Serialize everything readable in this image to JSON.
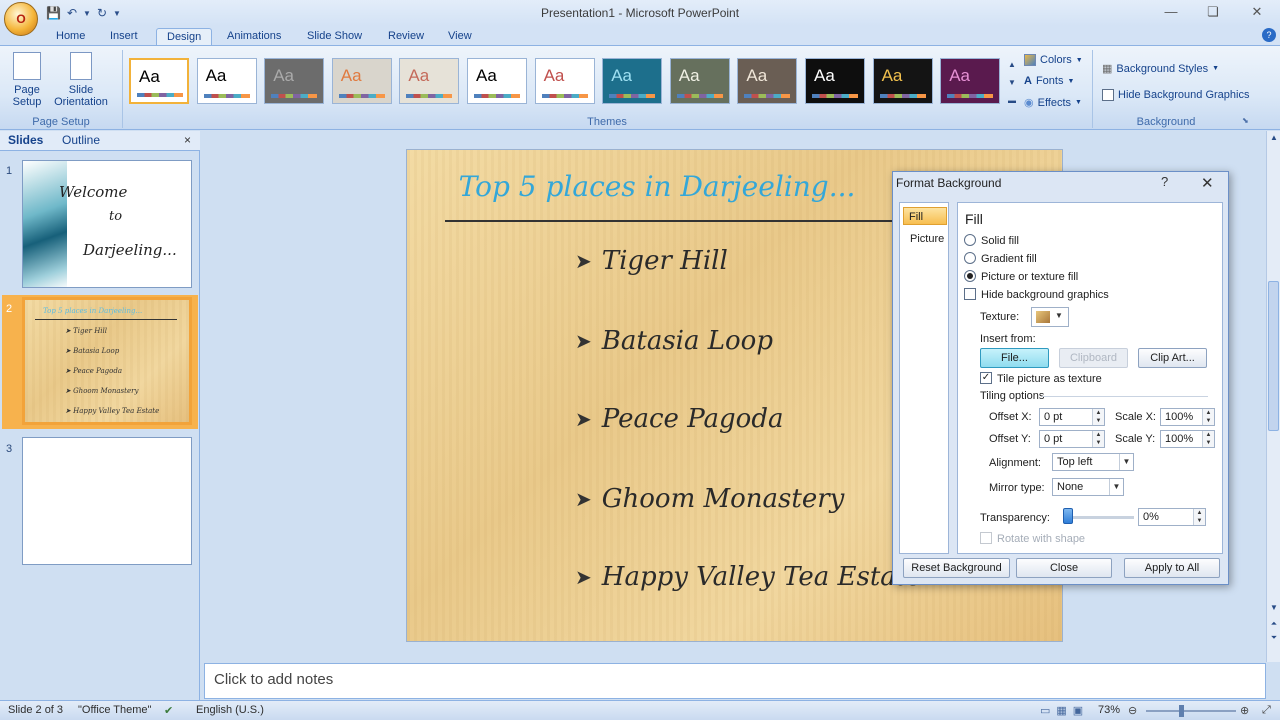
{
  "window": {
    "title": "Presentation1 - Microsoft PowerPoint",
    "office_button": "O"
  },
  "tabs": [
    "Home",
    "Insert",
    "Design",
    "Animations",
    "Slide Show",
    "Review",
    "View"
  ],
  "active_tab": "Design",
  "ribbon": {
    "page_setup": {
      "page_setup_label": "Page Setup",
      "slide_orientation_label": "Slide Orientation",
      "group_label": "Page Setup"
    },
    "themes": {
      "group_label": "Themes",
      "thumb_text": "Aa",
      "colors": [
        {
          "bg": "#ffffff",
          "fg": "#000000"
        },
        {
          "bg": "#ffffff",
          "fg": "#000000"
        },
        {
          "bg": "#6c6c6c",
          "fg": "#aaaaaa"
        },
        {
          "bg": "#d9d5cc",
          "fg": "#e07a3f"
        },
        {
          "bg": "#e6e2d8",
          "fg": "#c46a5a"
        },
        {
          "bg": "#ffffff",
          "fg": "#000000"
        },
        {
          "bg": "#ffffff",
          "fg": "#c0504d"
        },
        {
          "bg": "#1d6f8c",
          "fg": "#9ee0f2"
        },
        {
          "bg": "#66705d",
          "fg": "#f0f0e4"
        },
        {
          "bg": "#6a5e54",
          "fg": "#f0e6d8"
        },
        {
          "bg": "#0e0e0e",
          "fg": "#ffffff"
        },
        {
          "bg": "#141414",
          "fg": "#f2c14e"
        },
        {
          "bg": "#5a1a4e",
          "fg": "#e690d4"
        }
      ],
      "selected_index": 0
    },
    "theme_options": {
      "colors_label": "Colors",
      "fonts_label": "Fonts",
      "effects_label": "Effects"
    },
    "background": {
      "styles_label": "Background Styles",
      "hide_graphics_label": "Hide Background Graphics",
      "group_label": "Background"
    }
  },
  "left_pane": {
    "tabs": [
      "Slides",
      "Outline"
    ],
    "close_label": "×",
    "slides": [
      {
        "number": "1",
        "lines": [
          "Welcome",
          "to",
          "Darjeeling..."
        ]
      },
      {
        "number": "2",
        "title": "Top 5 places in Darjeeling...",
        "bullets": [
          "Tiger Hill",
          "Batasia Loop",
          "Peace Pagoda",
          "Ghoom Monastery",
          "Happy Valley Tea Estate"
        ]
      },
      {
        "number": "3"
      }
    ]
  },
  "slide": {
    "title": "Top 5 places in Darjeeling...",
    "bullet_symbol": "➤",
    "bullets": [
      "Tiger Hill",
      "Batasia Loop",
      "Peace Pagoda",
      "Ghoom Monastery",
      "Happy Valley Tea Estate"
    ]
  },
  "notes": {
    "placeholder": "Click to add notes"
  },
  "status_bar": {
    "slide_info": "Slide 2 of 3",
    "theme": "\"Office Theme\"",
    "language": "English (U.S.)",
    "zoom": "73%"
  },
  "dialog": {
    "title": "Format Background",
    "help": "?",
    "close": "✕",
    "nav": [
      "Fill",
      "Picture"
    ],
    "nav_selected": "Fill",
    "heading": "Fill",
    "options": {
      "solid_fill": "Solid fill",
      "gradient_fill": "Gradient fill",
      "picture_fill": "Picture or texture fill",
      "hide_graphics": "Hide background graphics"
    },
    "selected_option": "Picture or texture fill",
    "texture_label": "Texture:",
    "insert_from_label": "Insert from:",
    "buttons": {
      "file": "File...",
      "clipboard": "Clipboard",
      "clip_art": "Clip Art..."
    },
    "tile_label": "Tile picture as texture",
    "tile_checked": true,
    "tiling_options_label": "Tiling options",
    "offset_x_label": "Offset X:",
    "offset_x_value": "0 pt",
    "offset_y_label": "Offset Y:",
    "offset_y_value": "0 pt",
    "scale_x_label": "Scale X:",
    "scale_x_value": "100%",
    "scale_y_label": "Scale Y:",
    "scale_y_value": "100%",
    "alignment_label": "Alignment:",
    "alignment_value": "Top left",
    "mirror_label": "Mirror type:",
    "mirror_value": "None",
    "transparency_label": "Transparency:",
    "transparency_value": "0%",
    "rotate_label": "Rotate with shape",
    "footer": {
      "reset": "Reset Background",
      "close": "Close",
      "apply_all": "Apply to All"
    }
  }
}
